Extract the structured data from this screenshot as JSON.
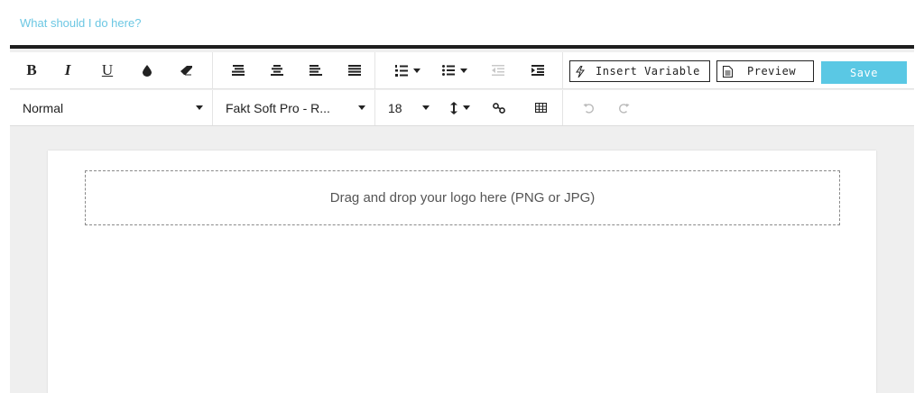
{
  "help_link": "What should I do here?",
  "toolbar": {
    "bold": "B",
    "italic": "I",
    "underline": "U",
    "insert_variable": "Insert Variable",
    "preview": "Preview",
    "save": "Save",
    "style_select": "Normal",
    "font_select": "Fakt Soft Pro - R...",
    "size_select": "18"
  },
  "canvas": {
    "dropzone_text": "Drag and drop your logo here (PNG or JPG)"
  },
  "colors": {
    "accent": "#5ac8e4",
    "link": "#6cc7e3",
    "toolbar_border": "#1e1e1e"
  }
}
